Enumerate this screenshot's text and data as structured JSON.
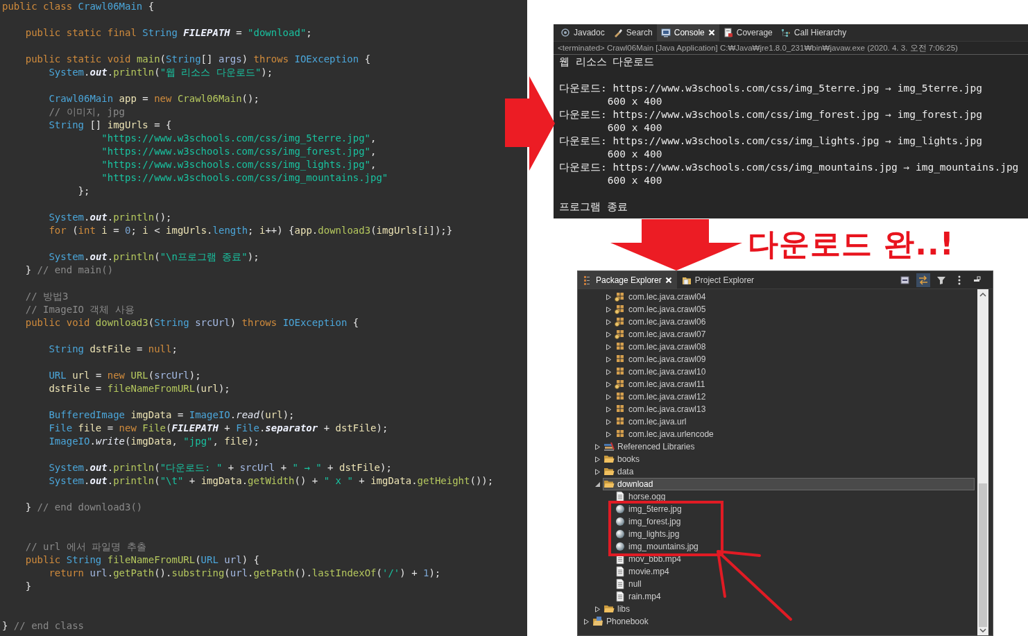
{
  "editor": {
    "lines": [
      {
        "kind": "code",
        "tokens": [
          {
            "kind": "kw",
            "text": "public class "
          },
          {
            "kind": "type",
            "text": "Crawl06Main"
          },
          {
            "kind": "plain",
            "text": " {"
          }
        ]
      },
      {
        "kind": "blank"
      },
      {
        "kind": "code",
        "tokens": [
          {
            "kind": "kw",
            "text": "    public static final "
          },
          {
            "kind": "type",
            "text": "String "
          },
          {
            "kind": "static",
            "text": "FILEPATH"
          },
          {
            "kind": "plain",
            "text": " = "
          },
          {
            "kind": "str",
            "text": "\"download\""
          },
          {
            "kind": "plain",
            "text": ";"
          }
        ]
      },
      {
        "kind": "blank"
      },
      {
        "kind": "code",
        "tokens": [
          {
            "kind": "kw",
            "text": "    public static void "
          },
          {
            "kind": "method",
            "text": "main"
          },
          {
            "kind": "plain",
            "text": "("
          },
          {
            "kind": "type",
            "text": "String"
          },
          {
            "kind": "plain",
            "text": "[] "
          },
          {
            "kind": "param",
            "text": "args"
          },
          {
            "kind": "plain",
            "text": ") "
          },
          {
            "kind": "kw",
            "text": "throws "
          },
          {
            "kind": "type",
            "text": "IOException"
          },
          {
            "kind": "plain",
            "text": " {"
          }
        ]
      },
      {
        "kind": "code",
        "tokens": [
          {
            "kind": "type",
            "text": "        System"
          },
          {
            "kind": "plain",
            "text": "."
          },
          {
            "kind": "static",
            "text": "out"
          },
          {
            "kind": "plain",
            "text": "."
          },
          {
            "kind": "method",
            "text": "println"
          },
          {
            "kind": "plain",
            "text": "("
          },
          {
            "kind": "str",
            "text": "\"웹 리소스 다운로드\""
          },
          {
            "kind": "plain",
            "text": ");"
          }
        ]
      },
      {
        "kind": "blank"
      },
      {
        "kind": "code",
        "tokens": [
          {
            "kind": "type",
            "text": "        Crawl06Main "
          },
          {
            "kind": "local",
            "text": "app"
          },
          {
            "kind": "plain",
            "text": " = "
          },
          {
            "kind": "kw",
            "text": "new "
          },
          {
            "kind": "method",
            "text": "Crawl06Main"
          },
          {
            "kind": "plain",
            "text": "();"
          }
        ]
      },
      {
        "kind": "code",
        "tokens": [
          {
            "kind": "comment",
            "text": "        // 이미지, jpg"
          }
        ]
      },
      {
        "kind": "code",
        "tokens": [
          {
            "kind": "type",
            "text": "        String "
          },
          {
            "kind": "plain",
            "text": "[] "
          },
          {
            "kind": "local",
            "text": "imgUrls"
          },
          {
            "kind": "plain",
            "text": " = {"
          }
        ]
      },
      {
        "kind": "code",
        "tokens": [
          {
            "kind": "str",
            "text": "                 \"https://www.w3schools.com/css/img_5terre.jpg\""
          },
          {
            "kind": "plain",
            "text": ","
          }
        ]
      },
      {
        "kind": "code",
        "tokens": [
          {
            "kind": "str",
            "text": "                 \"https://www.w3schools.com/css/img_forest.jpg\""
          },
          {
            "kind": "plain",
            "text": ","
          }
        ]
      },
      {
        "kind": "code",
        "tokens": [
          {
            "kind": "str",
            "text": "                 \"https://www.w3schools.com/css/img_lights.jpg\""
          },
          {
            "kind": "plain",
            "text": ","
          }
        ]
      },
      {
        "kind": "code",
        "tokens": [
          {
            "kind": "str",
            "text": "                 \"https://www.w3schools.com/css/img_mountains.jpg\""
          }
        ]
      },
      {
        "kind": "code",
        "tokens": [
          {
            "kind": "plain",
            "text": "             };"
          }
        ]
      },
      {
        "kind": "blank"
      },
      {
        "kind": "code",
        "tokens": [
          {
            "kind": "type",
            "text": "        System"
          },
          {
            "kind": "plain",
            "text": "."
          },
          {
            "kind": "static",
            "text": "out"
          },
          {
            "kind": "plain",
            "text": "."
          },
          {
            "kind": "method",
            "text": "println"
          },
          {
            "kind": "plain",
            "text": "();"
          }
        ]
      },
      {
        "kind": "code",
        "tokens": [
          {
            "kind": "kw",
            "text": "        for "
          },
          {
            "kind": "plain",
            "text": "("
          },
          {
            "kind": "kw",
            "text": "int "
          },
          {
            "kind": "local",
            "text": "i"
          },
          {
            "kind": "plain",
            "text": " = "
          },
          {
            "kind": "num",
            "text": "0"
          },
          {
            "kind": "plain",
            "text": "; "
          },
          {
            "kind": "local",
            "text": "i"
          },
          {
            "kind": "plain",
            "text": " < "
          },
          {
            "kind": "local",
            "text": "imgUrls"
          },
          {
            "kind": "plain",
            "text": "."
          },
          {
            "kind": "type",
            "text": "length"
          },
          {
            "kind": "plain",
            "text": "; "
          },
          {
            "kind": "local",
            "text": "i"
          },
          {
            "kind": "plain",
            "text": "++) {"
          },
          {
            "kind": "local",
            "text": "app"
          },
          {
            "kind": "plain",
            "text": "."
          },
          {
            "kind": "method",
            "text": "download3"
          },
          {
            "kind": "plain",
            "text": "("
          },
          {
            "kind": "local",
            "text": "imgUrls"
          },
          {
            "kind": "plain",
            "text": "["
          },
          {
            "kind": "local",
            "text": "i"
          },
          {
            "kind": "plain",
            "text": "]);}"
          }
        ]
      },
      {
        "kind": "blank"
      },
      {
        "kind": "code",
        "tokens": [
          {
            "kind": "type",
            "text": "        System"
          },
          {
            "kind": "plain",
            "text": "."
          },
          {
            "kind": "static",
            "text": "out"
          },
          {
            "kind": "plain",
            "text": "."
          },
          {
            "kind": "method",
            "text": "println"
          },
          {
            "kind": "plain",
            "text": "("
          },
          {
            "kind": "str",
            "text": "\"\\n프로그램 종료\""
          },
          {
            "kind": "plain",
            "text": ");"
          }
        ]
      },
      {
        "kind": "code",
        "tokens": [
          {
            "kind": "plain",
            "text": "    } "
          },
          {
            "kind": "comment",
            "text": "// end main()"
          }
        ]
      },
      {
        "kind": "blank"
      },
      {
        "kind": "code",
        "tokens": [
          {
            "kind": "comment",
            "text": "    // 방법3"
          }
        ]
      },
      {
        "kind": "code",
        "tokens": [
          {
            "kind": "comment",
            "text": "    // ImageIO 객체 사용"
          }
        ]
      },
      {
        "kind": "code",
        "tokens": [
          {
            "kind": "kw",
            "text": "    public void "
          },
          {
            "kind": "method",
            "text": "download3"
          },
          {
            "kind": "plain",
            "text": "("
          },
          {
            "kind": "type",
            "text": "String "
          },
          {
            "kind": "param",
            "text": "srcUrl"
          },
          {
            "kind": "plain",
            "text": ") "
          },
          {
            "kind": "kw",
            "text": "throws "
          },
          {
            "kind": "type",
            "text": "IOException"
          },
          {
            "kind": "plain",
            "text": " {"
          }
        ]
      },
      {
        "kind": "blank"
      },
      {
        "kind": "code",
        "tokens": [
          {
            "kind": "type",
            "text": "        String "
          },
          {
            "kind": "local",
            "text": "dstFile"
          },
          {
            "kind": "plain",
            "text": " = "
          },
          {
            "kind": "kw",
            "text": "null"
          },
          {
            "kind": "plain",
            "text": ";"
          }
        ]
      },
      {
        "kind": "blank"
      },
      {
        "kind": "code",
        "tokens": [
          {
            "kind": "type",
            "text": "        URL "
          },
          {
            "kind": "local",
            "text": "url"
          },
          {
            "kind": "plain",
            "text": " = "
          },
          {
            "kind": "kw",
            "text": "new "
          },
          {
            "kind": "method",
            "text": "URL"
          },
          {
            "kind": "plain",
            "text": "("
          },
          {
            "kind": "param",
            "text": "srcUrl"
          },
          {
            "kind": "plain",
            "text": ");"
          }
        ]
      },
      {
        "kind": "code",
        "tokens": [
          {
            "kind": "local",
            "text": "        dstFile"
          },
          {
            "kind": "plain",
            "text": " = "
          },
          {
            "kind": "method",
            "text": "fileNameFromURL"
          },
          {
            "kind": "plain",
            "text": "("
          },
          {
            "kind": "local",
            "text": "url"
          },
          {
            "kind": "plain",
            "text": ");"
          }
        ]
      },
      {
        "kind": "blank"
      },
      {
        "kind": "code",
        "tokens": [
          {
            "kind": "type",
            "text": "        BufferedImage "
          },
          {
            "kind": "local",
            "text": "imgData"
          },
          {
            "kind": "plain",
            "text": " = "
          },
          {
            "kind": "type",
            "text": "ImageIO"
          },
          {
            "kind": "plain",
            "text": "."
          },
          {
            "kind": "italic",
            "text": "read"
          },
          {
            "kind": "plain",
            "text": "("
          },
          {
            "kind": "local",
            "text": "url"
          },
          {
            "kind": "plain",
            "text": ");"
          }
        ]
      },
      {
        "kind": "code",
        "tokens": [
          {
            "kind": "type",
            "text": "        File "
          },
          {
            "kind": "local",
            "text": "file"
          },
          {
            "kind": "plain",
            "text": " = "
          },
          {
            "kind": "kw",
            "text": "new "
          },
          {
            "kind": "method",
            "text": "File"
          },
          {
            "kind": "plain",
            "text": "("
          },
          {
            "kind": "static",
            "text": "FILEPATH"
          },
          {
            "kind": "plain",
            "text": " + "
          },
          {
            "kind": "type",
            "text": "File"
          },
          {
            "kind": "plain",
            "text": "."
          },
          {
            "kind": "static",
            "text": "separator"
          },
          {
            "kind": "plain",
            "text": " + "
          },
          {
            "kind": "local",
            "text": "dstFile"
          },
          {
            "kind": "plain",
            "text": ");"
          }
        ]
      },
      {
        "kind": "code",
        "tokens": [
          {
            "kind": "type",
            "text": "        ImageIO"
          },
          {
            "kind": "plain",
            "text": "."
          },
          {
            "kind": "italic",
            "text": "write"
          },
          {
            "kind": "plain",
            "text": "("
          },
          {
            "kind": "local",
            "text": "imgData"
          },
          {
            "kind": "plain",
            "text": ", "
          },
          {
            "kind": "str",
            "text": "\"jpg\""
          },
          {
            "kind": "plain",
            "text": ", "
          },
          {
            "kind": "local",
            "text": "file"
          },
          {
            "kind": "plain",
            "text": ");"
          }
        ]
      },
      {
        "kind": "blank"
      },
      {
        "kind": "code",
        "tokens": [
          {
            "kind": "type",
            "text": "        System"
          },
          {
            "kind": "plain",
            "text": "."
          },
          {
            "kind": "static",
            "text": "out"
          },
          {
            "kind": "plain",
            "text": "."
          },
          {
            "kind": "method",
            "text": "println"
          },
          {
            "kind": "plain",
            "text": "("
          },
          {
            "kind": "str",
            "text": "\"다운로드: \""
          },
          {
            "kind": "plain",
            "text": " + "
          },
          {
            "kind": "param",
            "text": "srcUrl"
          },
          {
            "kind": "plain",
            "text": " + "
          },
          {
            "kind": "str",
            "text": "\" → \""
          },
          {
            "kind": "plain",
            "text": " + "
          },
          {
            "kind": "local",
            "text": "dstFile"
          },
          {
            "kind": "plain",
            "text": ");"
          }
        ]
      },
      {
        "kind": "code",
        "tokens": [
          {
            "kind": "type",
            "text": "        System"
          },
          {
            "kind": "plain",
            "text": "."
          },
          {
            "kind": "static",
            "text": "out"
          },
          {
            "kind": "plain",
            "text": "."
          },
          {
            "kind": "method",
            "text": "println"
          },
          {
            "kind": "plain",
            "text": "("
          },
          {
            "kind": "str",
            "text": "\"\\t\""
          },
          {
            "kind": "plain",
            "text": " + "
          },
          {
            "kind": "local",
            "text": "imgData"
          },
          {
            "kind": "plain",
            "text": "."
          },
          {
            "kind": "method",
            "text": "getWidth"
          },
          {
            "kind": "plain",
            "text": "() + "
          },
          {
            "kind": "str",
            "text": "\" x \""
          },
          {
            "kind": "plain",
            "text": " + "
          },
          {
            "kind": "local",
            "text": "imgData"
          },
          {
            "kind": "plain",
            "text": "."
          },
          {
            "kind": "method",
            "text": "getHeight"
          },
          {
            "kind": "plain",
            "text": "());"
          }
        ]
      },
      {
        "kind": "blank"
      },
      {
        "kind": "code",
        "tokens": [
          {
            "kind": "plain",
            "text": "    } "
          },
          {
            "kind": "comment",
            "text": "// end download3()"
          }
        ]
      },
      {
        "kind": "blank"
      },
      {
        "kind": "blank"
      },
      {
        "kind": "code",
        "tokens": [
          {
            "kind": "comment",
            "text": "    // url 에서 파일명 추출"
          }
        ]
      },
      {
        "kind": "code",
        "tokens": [
          {
            "kind": "kw",
            "text": "    public "
          },
          {
            "kind": "type",
            "text": "String "
          },
          {
            "kind": "method",
            "text": "fileNameFromURL"
          },
          {
            "kind": "plain",
            "text": "("
          },
          {
            "kind": "type",
            "text": "URL "
          },
          {
            "kind": "param",
            "text": "url"
          },
          {
            "kind": "plain",
            "text": ") {"
          }
        ]
      },
      {
        "kind": "code",
        "tokens": [
          {
            "kind": "kw",
            "text": "        return "
          },
          {
            "kind": "param",
            "text": "url"
          },
          {
            "kind": "plain",
            "text": "."
          },
          {
            "kind": "method",
            "text": "getPath"
          },
          {
            "kind": "plain",
            "text": "()."
          },
          {
            "kind": "method",
            "text": "substring"
          },
          {
            "kind": "plain",
            "text": "("
          },
          {
            "kind": "param",
            "text": "url"
          },
          {
            "kind": "plain",
            "text": "."
          },
          {
            "kind": "method",
            "text": "getPath"
          },
          {
            "kind": "plain",
            "text": "()."
          },
          {
            "kind": "method",
            "text": "lastIndexOf"
          },
          {
            "kind": "plain",
            "text": "("
          },
          {
            "kind": "str",
            "text": "'/'"
          },
          {
            "kind": "plain",
            "text": ") + "
          },
          {
            "kind": "num",
            "text": "1"
          },
          {
            "kind": "plain",
            "text": ");"
          }
        ]
      },
      {
        "kind": "code",
        "tokens": [
          {
            "kind": "plain",
            "text": "    }"
          }
        ]
      },
      {
        "kind": "blank"
      },
      {
        "kind": "blank"
      },
      {
        "kind": "code",
        "tokens": [
          {
            "kind": "plain",
            "text": "} "
          },
          {
            "kind": "comment",
            "text": "// end class"
          }
        ]
      }
    ]
  },
  "console": {
    "tabs": [
      {
        "label": "Javadoc",
        "kind": "javadoc",
        "selected": false
      },
      {
        "label": "Search",
        "kind": "search",
        "selected": false
      },
      {
        "label": "Console",
        "kind": "console",
        "selected": true
      },
      {
        "label": "Coverage",
        "kind": "coverage",
        "selected": false
      },
      {
        "label": "Call Hierarchy",
        "kind": "hierarchy",
        "selected": false
      }
    ],
    "status": "<terminated> Crawl06Main [Java Application] C:₩Java₩jre1.8.0_231₩bin₩javaw.exe (2020. 4. 3. 오전 7:06:25)",
    "output": [
      {
        "kind": "text",
        "text": "웹 리소스 다운로드"
      },
      {
        "kind": "blank"
      },
      {
        "kind": "text",
        "text": "다운로드: https://www.w3schools.com/css/img_5terre.jpg → img_5terre.jpg"
      },
      {
        "kind": "text",
        "text": "\t600 x 400"
      },
      {
        "kind": "text",
        "text": "다운로드: https://www.w3schools.com/css/img_forest.jpg → img_forest.jpg"
      },
      {
        "kind": "text",
        "text": "\t600 x 400"
      },
      {
        "kind": "text",
        "text": "다운로드: https://www.w3schools.com/css/img_lights.jpg → img_lights.jpg"
      },
      {
        "kind": "text",
        "text": "\t600 x 400"
      },
      {
        "kind": "text",
        "text": "다운로드: https://www.w3schools.com/css/img_mountains.jpg → img_mountains.jpg"
      },
      {
        "kind": "text",
        "text": "\t600 x 400"
      },
      {
        "kind": "blank"
      },
      {
        "kind": "text",
        "text": "프로그램 종료"
      }
    ]
  },
  "annotation": "다운로드 완..!",
  "explorer": {
    "tabs": [
      {
        "label": "Package Explorer",
        "kind": "package-explorer",
        "selected": true
      },
      {
        "label": "Project Explorer",
        "kind": "project-explorer",
        "selected": false
      }
    ],
    "toolbar": [
      {
        "kind": "collapse-all",
        "on": false
      },
      {
        "kind": "link",
        "on": true
      },
      {
        "kind": "filter",
        "on": false
      },
      {
        "kind": "menu",
        "on": false
      },
      {
        "kind": "minimize",
        "on": false
      }
    ],
    "tree": [
      {
        "children": [
          {
            "children": [
              {
                "label": "com.lec.java.crawl04",
                "kind": "package-badge",
                "expanded": false,
                "selected": false
              },
              {
                "label": "com.lec.java.crawl05",
                "kind": "package-badge",
                "expanded": false,
                "selected": false
              },
              {
                "label": "com.lec.java.crawl06",
                "kind": "package-badge",
                "expanded": false,
                "selected": false
              },
              {
                "label": "com.lec.java.crawl07",
                "kind": "package-badge",
                "expanded": false,
                "selected": false
              },
              {
                "label": "com.lec.java.crawl08",
                "kind": "package",
                "expanded": false,
                "selected": false
              },
              {
                "label": "com.lec.java.crawl09",
                "kind": "package",
                "expanded": false,
                "selected": false
              },
              {
                "label": "com.lec.java.crawl10",
                "kind": "package",
                "expanded": false,
                "selected": false
              },
              {
                "label": "com.lec.java.crawl11",
                "kind": "package-badge",
                "expanded": false,
                "selected": false
              },
              {
                "label": "com.lec.java.crawl12",
                "kind": "package",
                "expanded": false,
                "selected": false
              },
              {
                "label": "com.lec.java.crawl13",
                "kind": "package",
                "expanded": false,
                "selected": false
              },
              {
                "label": "com.lec.java.url",
                "kind": "package",
                "expanded": false,
                "selected": false
              },
              {
                "label": "com.lec.java.urlencode",
                "kind": "package",
                "expanded": false,
                "selected": false
              }
            ]
          },
          {
            "label": "Referenced Libraries",
            "kind": "library",
            "expanded": false,
            "selected": false
          },
          {
            "label": "books",
            "kind": "folder",
            "expanded": false,
            "selected": false
          },
          {
            "label": "data",
            "kind": "folder",
            "expanded": false,
            "selected": false
          },
          {
            "label": "download",
            "kind": "folder",
            "expanded": true,
            "selected": true,
            "children": [
              {
                "label": "horse.ogg",
                "kind": "file",
                "selected": false
              },
              {
                "label": "img_5terre.jpg",
                "kind": "image",
                "selected": false
              },
              {
                "label": "img_forest.jpg",
                "kind": "image",
                "selected": false
              },
              {
                "label": "img_lights.jpg",
                "kind": "image",
                "selected": false
              },
              {
                "label": "img_mountains.jpg",
                "kind": "image",
                "selected": false
              },
              {
                "label": "mov_bbb.mp4",
                "kind": "file",
                "selected": false
              },
              {
                "label": "movie.mp4",
                "kind": "file",
                "selected": false
              },
              {
                "label": "null",
                "kind": "file",
                "selected": false
              },
              {
                "label": "rain.mp4",
                "kind": "file",
                "selected": false
              }
            ]
          },
          {
            "label": "libs",
            "kind": "folder",
            "expanded": false,
            "selected": false
          }
        ]
      },
      {
        "label": "Phonebook",
        "kind": "project",
        "expanded": false,
        "selected": false
      }
    ]
  }
}
